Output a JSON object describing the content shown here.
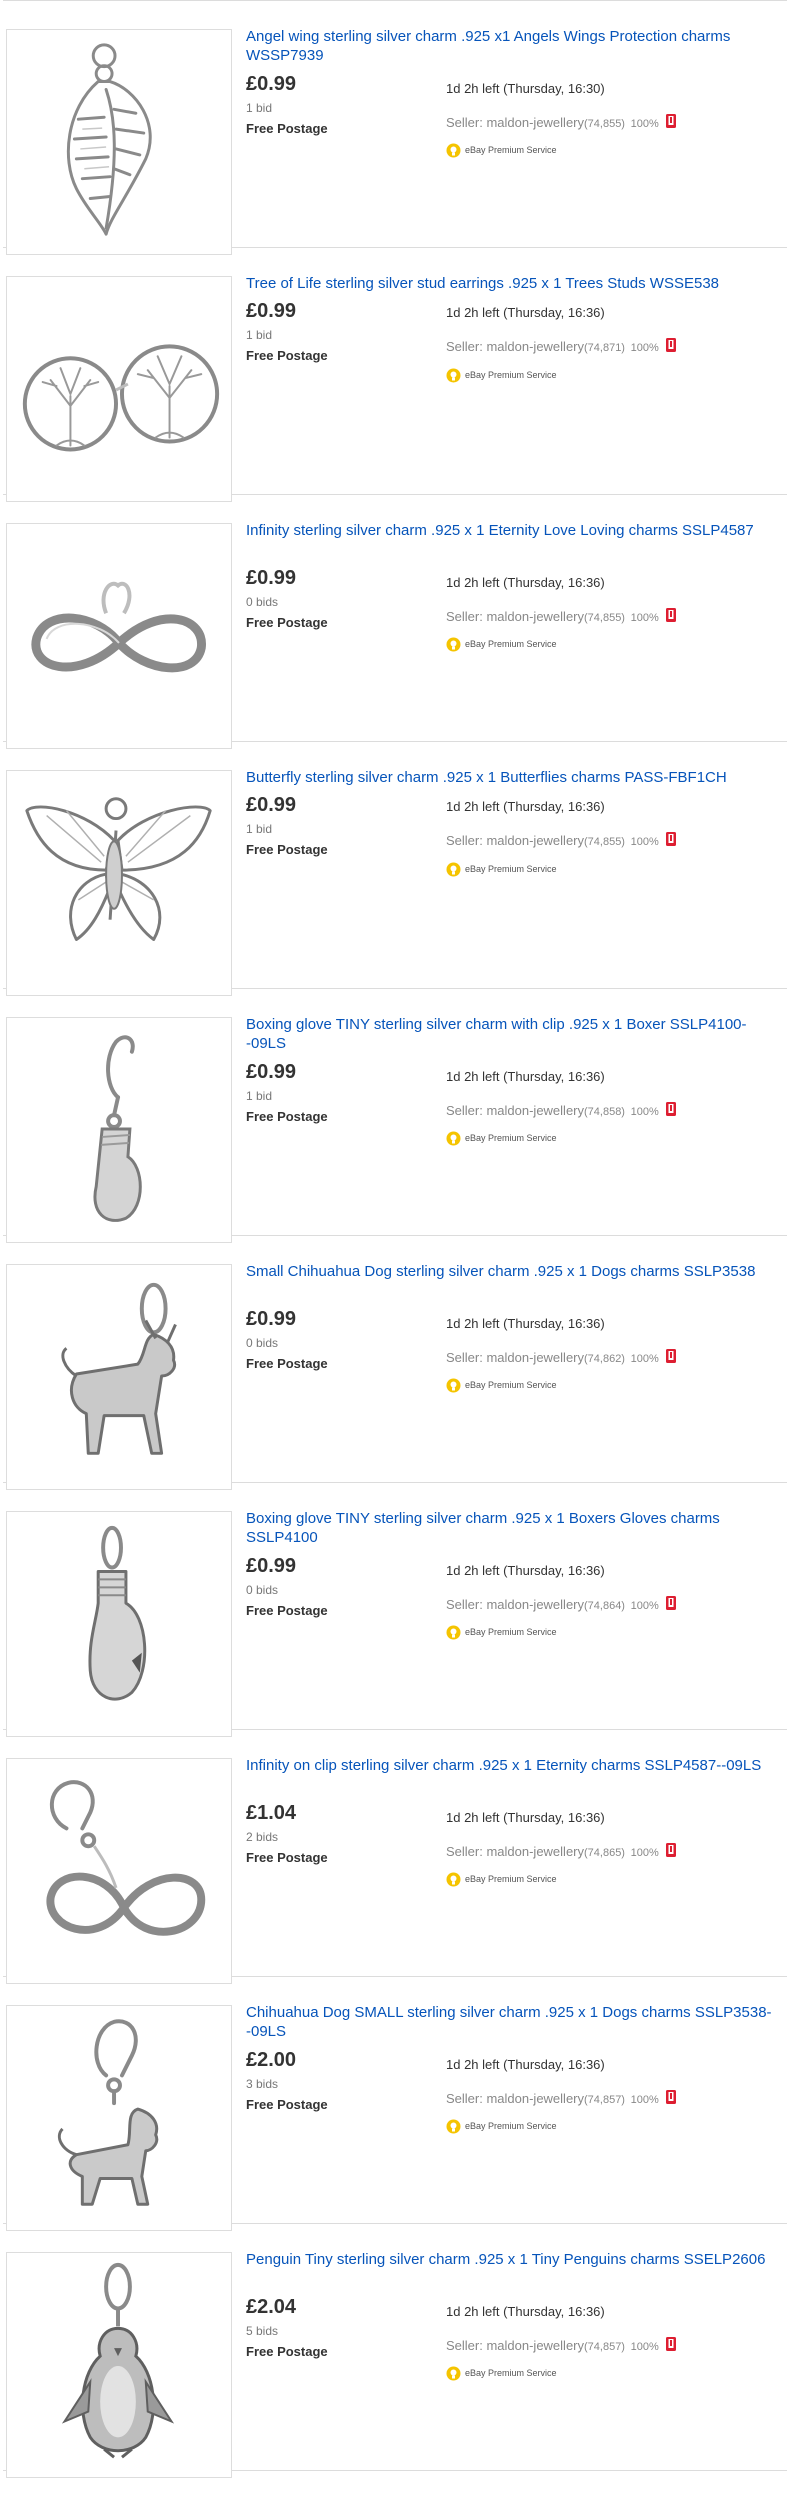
{
  "listings": [
    {
      "title": "Angel wing sterling silver charm .925 x1 Angels Wings Protection charms WSSP7939",
      "price": "£0.99",
      "bids": "1 bid",
      "postage": "Free Postage",
      "time_left": "1d 2h left (Thursday, 16:30)",
      "seller_label": "Seller: maldon-jewellery",
      "feedback_count": "(74,855)",
      "positive_percent": "100%",
      "premium_label": "eBay Premium Service",
      "image_icon": "angel-wing-charm"
    },
    {
      "title": "Tree of Life sterling silver stud earrings .925 x 1 Trees Studs WSSE538",
      "price": "£0.99",
      "bids": "1 bid",
      "postage": "Free Postage",
      "time_left": "1d 2h left (Thursday, 16:36)",
      "seller_label": "Seller: maldon-jewellery",
      "feedback_count": "(74,871)",
      "positive_percent": "100%",
      "premium_label": "eBay Premium Service",
      "image_icon": "tree-of-life-earrings"
    },
    {
      "title": "Infinity sterling silver charm .925 x 1 Eternity Love Loving charms SSLP4587",
      "price": "£0.99",
      "bids": "0 bids",
      "postage": "Free Postage",
      "time_left": "1d 2h left (Thursday, 16:36)",
      "seller_label": "Seller: maldon-jewellery",
      "feedback_count": "(74,855)",
      "positive_percent": "100%",
      "premium_label": "eBay Premium Service",
      "image_icon": "infinity-charm"
    },
    {
      "title": "Butterfly sterling silver charm .925 x 1 Butterflies charms PASS-FBF1CH",
      "price": "£0.99",
      "bids": "1 bid",
      "postage": "Free Postage",
      "time_left": "1d 2h left (Thursday, 16:36)",
      "seller_label": "Seller: maldon-jewellery",
      "feedback_count": "(74,855)",
      "positive_percent": "100%",
      "premium_label": "eBay Premium Service",
      "image_icon": "butterfly-charm"
    },
    {
      "title": "Boxing glove TINY sterling silver charm with clip .925 x 1 Boxer SSLP4100--09LS",
      "price": "£0.99",
      "bids": "1 bid",
      "postage": "Free Postage",
      "time_left": "1d 2h left (Thursday, 16:36)",
      "seller_label": "Seller: maldon-jewellery",
      "feedback_count": "(74,858)",
      "positive_percent": "100%",
      "premium_label": "eBay Premium Service",
      "image_icon": "boxing-glove-clip-charm"
    },
    {
      "title": "Small Chihuahua Dog sterling silver charm .925 x 1 Dogs charms SSLP3538",
      "price": "£0.99",
      "bids": "0 bids",
      "postage": "Free Postage",
      "time_left": "1d 2h left (Thursday, 16:36)",
      "seller_label": "Seller: maldon-jewellery",
      "feedback_count": "(74,862)",
      "positive_percent": "100%",
      "premium_label": "eBay Premium Service",
      "image_icon": "chihuahua-charm"
    },
    {
      "title": "Boxing glove TINY sterling silver charm .925 x 1 Boxers Gloves charms SSLP4100",
      "price": "£0.99",
      "bids": "0 bids",
      "postage": "Free Postage",
      "time_left": "1d 2h left (Thursday, 16:36)",
      "seller_label": "Seller: maldon-jewellery",
      "feedback_count": "(74,864)",
      "positive_percent": "100%",
      "premium_label": "eBay Premium Service",
      "image_icon": "boxing-glove-charm"
    },
    {
      "title": "Infinity on clip sterling silver charm .925 x 1 Eternity charms SSLP4587--09LS",
      "price": "£1.04",
      "bids": "2 bids",
      "postage": "Free Postage",
      "time_left": "1d 2h left (Thursday, 16:36)",
      "seller_label": "Seller: maldon-jewellery",
      "feedback_count": "(74,865)",
      "positive_percent": "100%",
      "premium_label": "eBay Premium Service",
      "image_icon": "infinity-clip-charm"
    },
    {
      "title": "Chihuahua Dog SMALL sterling silver charm .925 x 1 Dogs charms SSLP3538--09LS",
      "price": "£2.00",
      "bids": "3 bids",
      "postage": "Free Postage",
      "time_left": "1d 2h left (Thursday, 16:36)",
      "seller_label": "Seller: maldon-jewellery",
      "feedback_count": "(74,857)",
      "positive_percent": "100%",
      "premium_label": "eBay Premium Service",
      "image_icon": "chihuahua-clip-charm"
    },
    {
      "title": "Penguin Tiny sterling silver charm .925 x 1 Tiny Penguins charms SSELP2606",
      "price": "£2.04",
      "bids": "5 bids",
      "postage": "Free Postage",
      "time_left": "1d 2h left (Thursday, 16:36)",
      "seller_label": "Seller: maldon-jewellery",
      "feedback_count": "(74,857)",
      "positive_percent": "100%",
      "premium_label": "eBay Premium Service",
      "image_icon": "penguin-charm"
    }
  ],
  "colors": {
    "title_link": "#0654ba",
    "price": "#333333",
    "secondary_text": "#777777",
    "top_rated_icon": "#dd1e31",
    "premium_icon": "#f5c400"
  }
}
